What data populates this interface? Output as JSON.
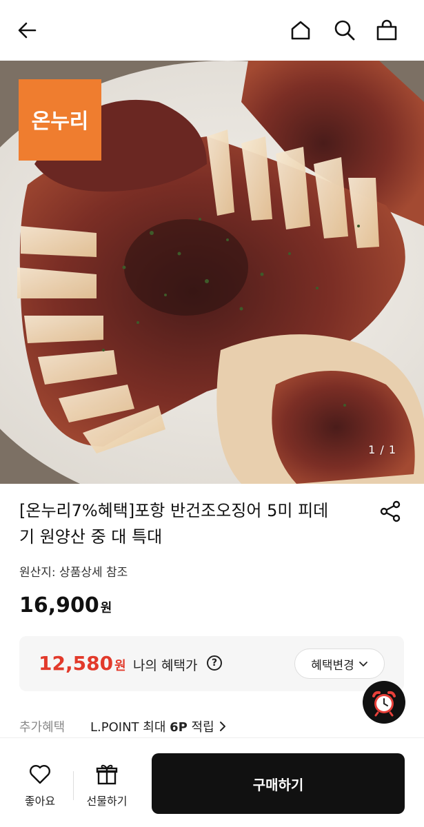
{
  "header": {
    "back_icon": "arrow-left-icon",
    "home_icon": "home-icon",
    "search_icon": "search-icon",
    "cart_icon": "shopping-bag-icon"
  },
  "hero": {
    "logo_text": "온누리",
    "pager": "1 / 1",
    "logo_color": "#ef7d2f"
  },
  "product": {
    "title_line1": "[온누리7%혜택]포항 반건조오징어 5미 피데",
    "title_line2": "기 원양산 중 대 특대",
    "share_icon": "share-icon",
    "origin": "원산지: 상품상세 참조",
    "price": "16,900",
    "price_unit": "원"
  },
  "benefit": {
    "price": "12,580",
    "price_unit": "원",
    "label": "나의 혜택가",
    "help_icon": "?",
    "change_label": "혜택변경",
    "accent_color": "#e23a2b"
  },
  "extra": {
    "label": "추가혜택",
    "link_prefix": "L.POINT 최대 ",
    "link_bold": "6P",
    "link_suffix": " 적립"
  },
  "floating": {
    "alarm_icon": "alarm-clock-icon"
  },
  "bottom_bar": {
    "like_label": "좋아요",
    "gift_label": "선물하기",
    "buy_label": "구매하기"
  }
}
